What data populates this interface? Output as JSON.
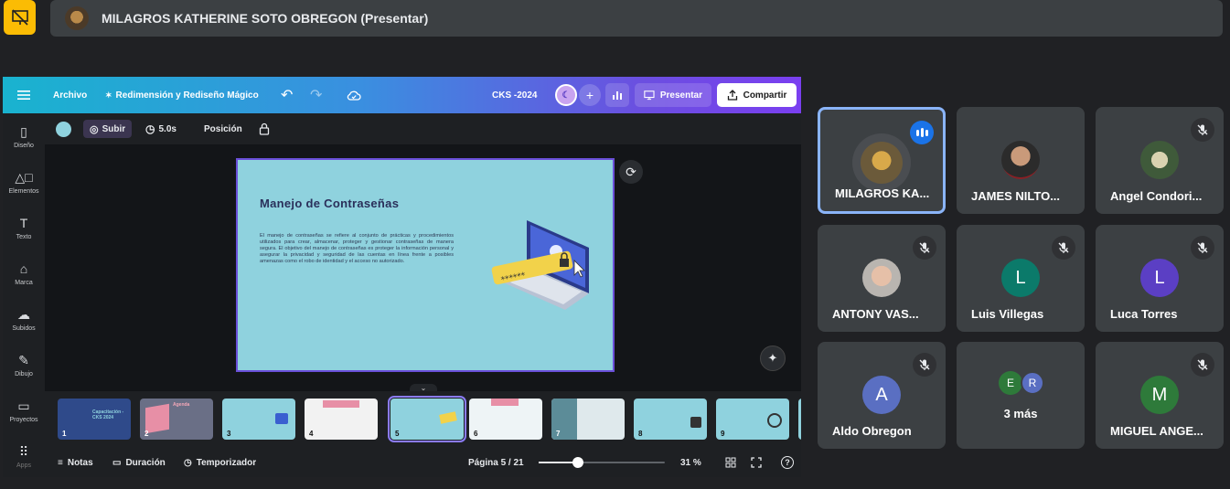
{
  "meet": {
    "presenter_label": "MILAGROS KATHERINE SOTO OBREGON (Presentar)",
    "participants": [
      {
        "name": "MILAGROS KA...",
        "avatar": "photo",
        "status": "speaking"
      },
      {
        "name": "JAMES NILTO...",
        "avatar": "photo",
        "status": "none"
      },
      {
        "name": "Angel Condori...",
        "avatar": "photo",
        "status": "muted"
      },
      {
        "name": "ANTONY VAS...",
        "avatar": "photo",
        "status": "muted"
      },
      {
        "name": "Luis Villegas",
        "avatar": "L",
        "avatar_color": "#0b7a6a",
        "status": "muted"
      },
      {
        "name": "Luca Torres",
        "avatar": "L",
        "avatar_color": "#5b3fc4",
        "status": "muted"
      },
      {
        "name": "Aldo Obregon",
        "avatar": "A",
        "avatar_color": "#5a6fc2",
        "status": "muted"
      },
      {
        "name": "3 más",
        "avatar": "E R",
        "status": "none"
      },
      {
        "name": "MIGUEL ANGE...",
        "avatar": "M",
        "avatar_color": "#2e7a3a",
        "status": "muted"
      }
    ]
  },
  "canva": {
    "menu": {
      "archivo": "Archivo",
      "magic": "Redimensión y Rediseño Mágico",
      "doc_title": "CKS -2024",
      "present": "Presentar",
      "share": "Compartir"
    },
    "sidebar": [
      {
        "label": "Diseño",
        "icon": "layout-icon"
      },
      {
        "label": "Elementos",
        "icon": "elements-icon"
      },
      {
        "label": "Texto",
        "icon": "text-icon"
      },
      {
        "label": "Marca",
        "icon": "brand-icon"
      },
      {
        "label": "Subidos",
        "icon": "cloud-upload-icon"
      },
      {
        "label": "Dibujo",
        "icon": "pen-icon"
      },
      {
        "label": "Proyectos",
        "icon": "folder-icon"
      },
      {
        "label": "Apps",
        "icon": "apps-icon"
      }
    ],
    "toolbar": {
      "animate": "Subir",
      "duration": "5.0s",
      "position": "Posición"
    },
    "slide": {
      "title": "Manejo de Contraseñas",
      "body": "El manejo de contraseñas se refiere al conjunto de prácticas y procedimientos utilizados para crear, almacenar, proteger y gestionar contraseñas de manera segura. El objetivo del manejo de contraseñas es proteger la información personal y asegurar la privacidad y seguridad de las cuentas en línea frente a posibles amenazas como el robo de identidad y el acceso no autorizado.",
      "bg_color": "#8fd2de"
    },
    "thumbnails": [
      {
        "num": "1",
        "title": "Capacitación - CKS 2024",
        "bg": "#2f4a8a"
      },
      {
        "num": "2",
        "title": "Agenda",
        "bg": "#6a6f86"
      },
      {
        "num": "3",
        "title": "",
        "bg": "#8fd2de"
      },
      {
        "num": "4",
        "title": "",
        "bg": "#f2f2f2"
      },
      {
        "num": "5",
        "title": "",
        "bg": "#8fd2de"
      },
      {
        "num": "6",
        "title": "",
        "bg": "#eef4f6"
      },
      {
        "num": "7",
        "title": "",
        "bg": "#dfe9ec"
      },
      {
        "num": "8",
        "title": "",
        "bg": "#8fd2de"
      },
      {
        "num": "9",
        "title": "",
        "bg": "#8fd2de"
      }
    ],
    "bottom": {
      "notes": "Notas",
      "duration": "Duración",
      "timer": "Temporizador",
      "page": "Página 5 / 21",
      "zoom": "31 %",
      "zoom_fraction": 0.31
    }
  }
}
